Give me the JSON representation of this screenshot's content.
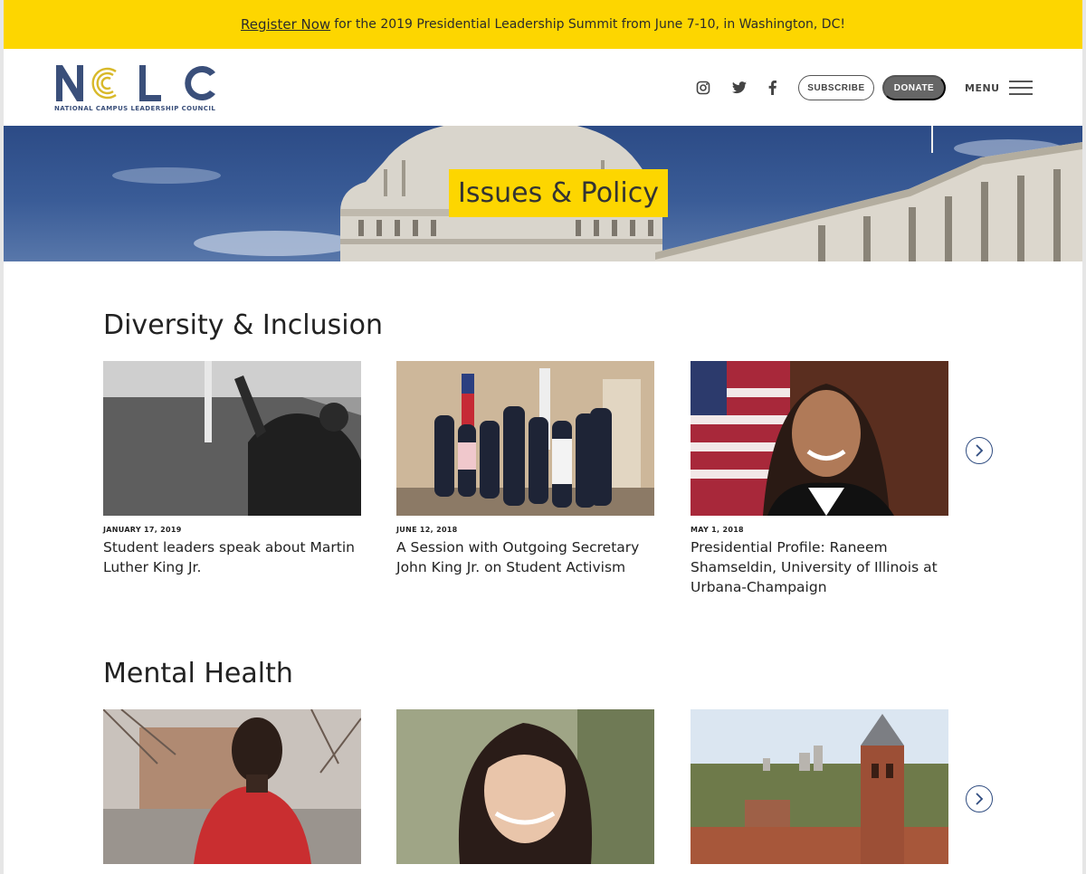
{
  "announcement": {
    "link_text": "Register Now",
    "text": "for the 2019 Presidential Leadership Summit from June 7-10, in Washington, DC!"
  },
  "header": {
    "logo_text": "NCLC",
    "logo_tagline": "NATIONAL CAMPUS LEADERSHIP COUNCIL",
    "social": [
      "instagram-icon",
      "twitter-icon",
      "facebook-icon"
    ],
    "subscribe_label": "SUBSCRIBE",
    "donate_label": "DONATE",
    "menu_label": "MENU"
  },
  "hero": {
    "title": "Issues & Policy"
  },
  "colors": {
    "accent_yellow": "#fdd600",
    "brand_blue": "#3a4f7a",
    "logo_gold": "#d8b92a"
  },
  "sections": [
    {
      "title": "Diversity & Inclusion",
      "cards": [
        {
          "date": "JANUARY 17, 2019",
          "headline": "Student leaders speak about Martin Luther King Jr."
        },
        {
          "date": "JUNE 12, 2018",
          "headline": "A Session with Outgoing Secretary John King Jr. on Student Activism"
        },
        {
          "date": "MAY 1, 2018",
          "headline": "Presidential Profile: Raneem Shamseldin, University of Illinois at Urbana-Champaign"
        }
      ]
    },
    {
      "title": "Mental Health",
      "cards": [
        {
          "date": "",
          "headline": ""
        },
        {
          "date": "",
          "headline": ""
        },
        {
          "date": "",
          "headline": ""
        }
      ]
    }
  ]
}
